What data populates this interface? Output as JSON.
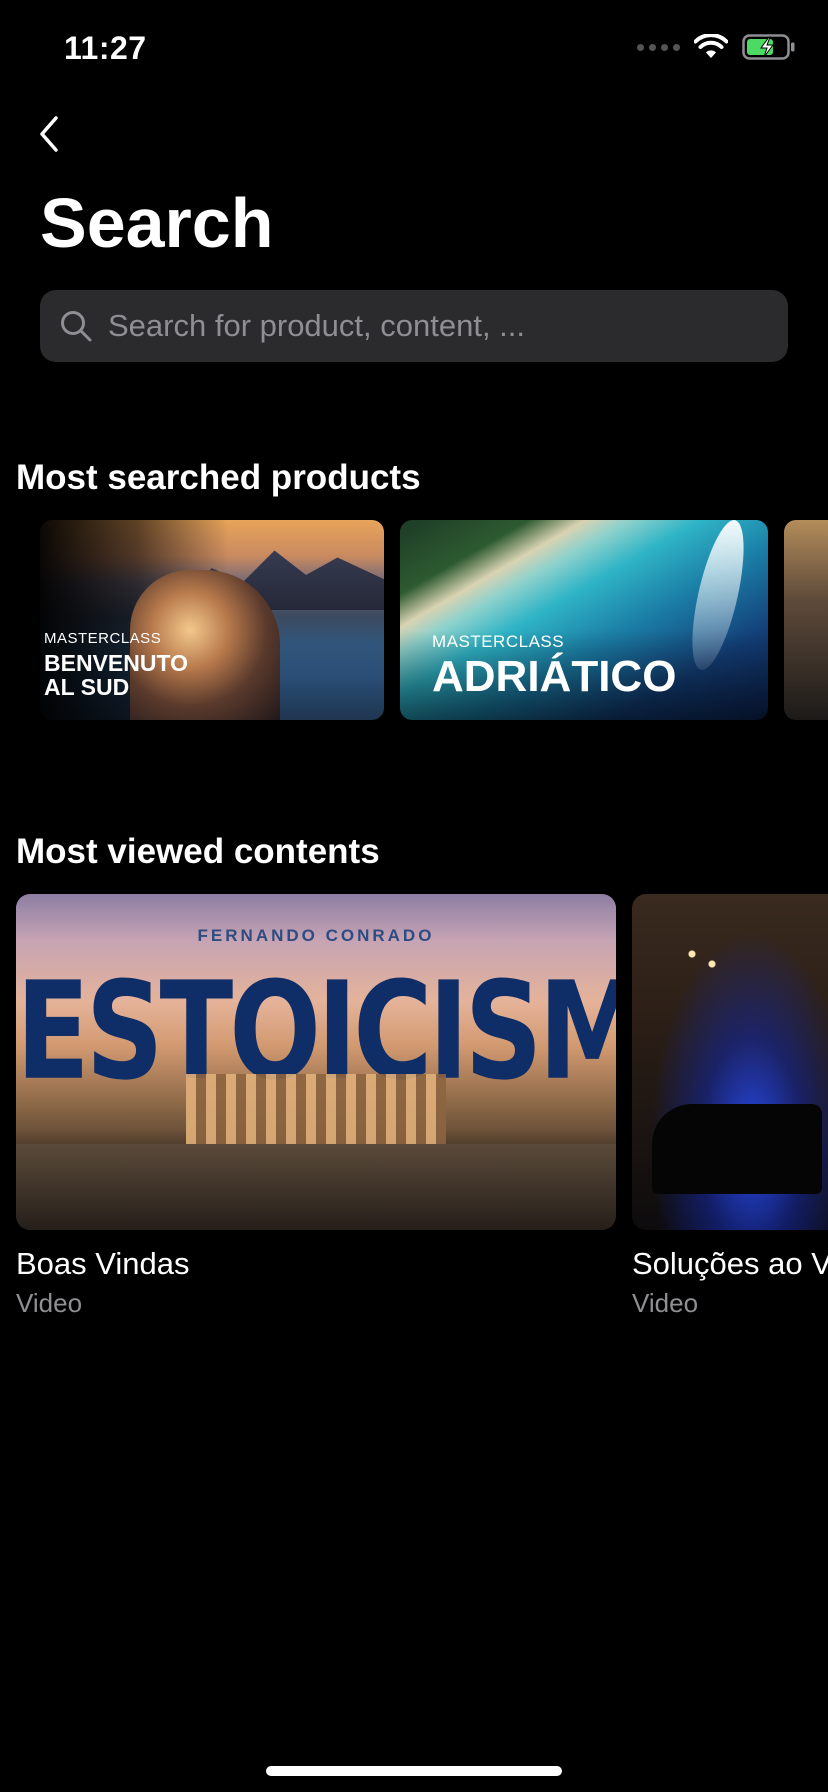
{
  "status_bar": {
    "time": "11:27"
  },
  "header": {
    "title": "Search"
  },
  "search": {
    "placeholder": "Search for product, content, ..."
  },
  "most_searched": {
    "title": "Most searched products",
    "items": [
      {
        "label_small": "MASTERCLASS",
        "label_big_line1": "BENVENUTO",
        "label_big_line2": "AL SUD"
      },
      {
        "label_small": "MASTERCLASS",
        "label_big_line1": "ADRIÁTICO"
      },
      {
        "label_small": "",
        "label_big_line1": ""
      }
    ]
  },
  "most_viewed": {
    "title": "Most viewed contents",
    "items": [
      {
        "thumb_author": "FERNANDO CONRADO",
        "thumb_headline": "ESTOICISMO",
        "title": "Boas Vindas",
        "type": "Video"
      },
      {
        "title": "Soluções ao VS",
        "type": "Video"
      }
    ]
  },
  "colors": {
    "background": "#000000",
    "search_bg": "#2b2b2d",
    "secondary_text": "#8e8e93",
    "battery": "#4cd964"
  }
}
